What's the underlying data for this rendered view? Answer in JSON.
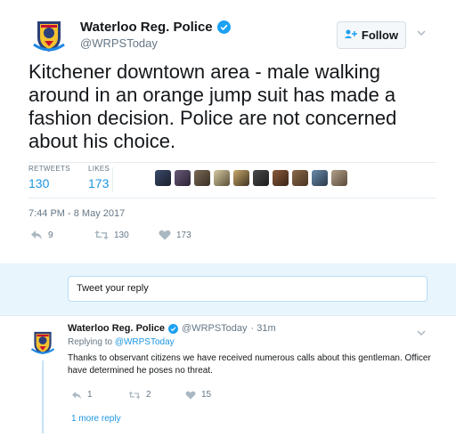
{
  "tweet": {
    "author_name": "Waterloo Reg. Police",
    "author_handle": "@WRPSToday",
    "follow_label": "Follow",
    "text": "Kitchener downtown area - male walking around in an orange jump suit has made a fashion decision. Police are not concerned about his choice.",
    "retweets_label": "RETWEETS",
    "retweets_count": "130",
    "likes_label": "LIKES",
    "likes_count": "173",
    "timestamp": "7:44 PM - 8 May 2017",
    "actions": {
      "reply_count": "9",
      "retweet_count": "130",
      "like_count": "173"
    }
  },
  "reply_box": {
    "placeholder": "Tweet your reply"
  },
  "reply": {
    "author_name": "Waterloo Reg. Police",
    "author_handle": "@WRPSToday",
    "time": "· 31m",
    "replying_prefix": "Replying to",
    "replying_handle": "@WRPSToday",
    "text": "Thanks to observant citizens we have received numerous calls about this gentleman. Officer have determined he poses no threat.",
    "actions": {
      "reply_count": "1",
      "retweet_count": "2",
      "like_count": "15"
    },
    "more_replies": "1 more reply"
  },
  "colors": {
    "accent": "#1b95e0",
    "verified": "#1da1f2",
    "reply_bg": "#e8f5fd",
    "muted": "#657786"
  },
  "icons": [
    "badge-logo",
    "verified-icon",
    "follow-icon",
    "chevron-down-icon",
    "reply-icon",
    "retweet-icon",
    "heart-icon"
  ]
}
